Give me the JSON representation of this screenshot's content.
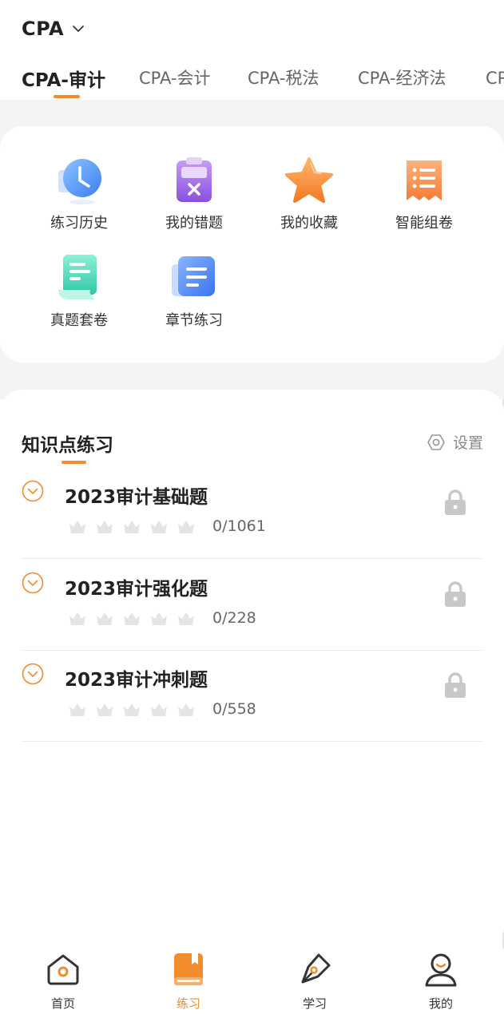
{
  "header": {
    "exam": "CPA",
    "tabs": [
      "CPA-审计",
      "CPA-会计",
      "CPA-税法",
      "CPA-经济法",
      "CPA-财管"
    ],
    "active_tab": 0
  },
  "quick": [
    {
      "label": "练习历史",
      "icon": "clock-icon"
    },
    {
      "label": "我的错题",
      "icon": "wrong-clipboard-icon"
    },
    {
      "label": "我的收藏",
      "icon": "star-icon"
    },
    {
      "label": "智能组卷",
      "icon": "smart-paper-icon"
    },
    {
      "label": "真题套卷",
      "icon": "exam-paper-icon"
    },
    {
      "label": "章节练习",
      "icon": "chapter-doc-icon"
    }
  ],
  "knowledge": {
    "title": "知识点练习",
    "settings_label": "设置",
    "items": [
      {
        "title": "2023审计基础题",
        "progress": "0/1061",
        "stars_earned": 0,
        "locked": true
      },
      {
        "title": "2023审计强化题",
        "progress": "0/228",
        "stars_earned": 0,
        "locked": true
      },
      {
        "title": "2023审计冲刺题",
        "progress": "0/558",
        "stars_earned": 0,
        "locked": true
      }
    ]
  },
  "nav": [
    {
      "label": "首页",
      "icon": "home-icon"
    },
    {
      "label": "练习",
      "icon": "practice-book-icon"
    },
    {
      "label": "学习",
      "icon": "pen-nib-icon"
    },
    {
      "label": "我的",
      "icon": "profile-icon"
    }
  ],
  "nav_active": 1,
  "colors": {
    "accent": "#f28b2c",
    "locked": "#c8c8c8",
    "crown": "#e4e4e4"
  }
}
